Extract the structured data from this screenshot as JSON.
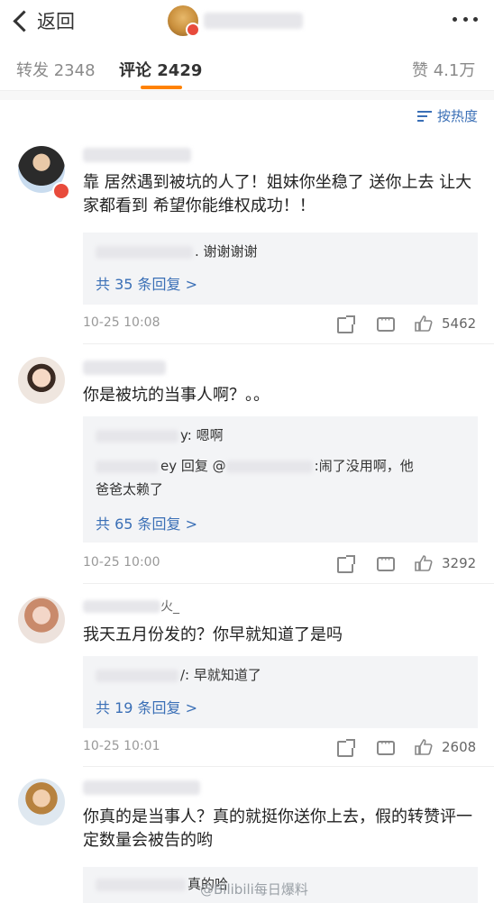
{
  "header": {
    "back_label": "返回"
  },
  "tabs": {
    "repost": "转发 2348",
    "comment": "评论 2429",
    "like": "赞 4.1万"
  },
  "sort": {
    "label": "按热度"
  },
  "comments": [
    {
      "text": "靠 居然遇到被坑的人了！姐妹你坐稳了 送你上去 让大家都看到 希望你能维权成功！！",
      "replies": [
        {
          "text": ". 谢谢谢谢"
        }
      ],
      "more_replies": "共 35 条回复 >",
      "time": "10-25 10:08",
      "likes": "5462"
    },
    {
      "text": "你是被坑的当事人啊？。。",
      "replies": [
        {
          "text": "y: 嗯啊"
        },
        {
          "text": "ey 回复 @",
          "text2": ":闹了没用啊，他",
          "text3": "爸爸太赖了"
        }
      ],
      "more_replies": "共 65 条回复 >",
      "time": "10-25 10:00",
      "likes": "3292"
    },
    {
      "name_suffix": "火_",
      "text": "我天五月份发的？你早就知道了是吗",
      "replies": [
        {
          "text": "/: 早就知道了"
        }
      ],
      "more_replies": "共 19 条回复 >",
      "time": "10-25 10:01",
      "likes": "2608"
    },
    {
      "text": "你真的是当事人？真的就挺你送你上去，假的转赞评一定数量会被告的哟",
      "replies": [
        {
          "text": "真的哈"
        }
      ]
    }
  ],
  "watermark": "@Bilibili每日爆料",
  "colors": {
    "accent": "#ff8200",
    "link": "#3a6fb6",
    "reply_bg": "#f3f4f6"
  }
}
